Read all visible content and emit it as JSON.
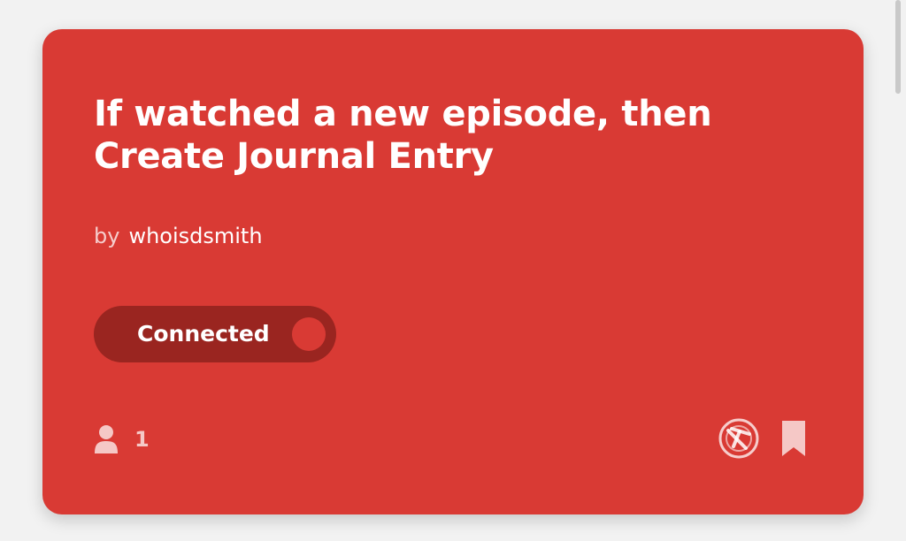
{
  "applet": {
    "title": "If watched a new episode, then Create Journal Entry",
    "by_label": "by",
    "author": "whoisdsmith",
    "toggle_label": "Connected",
    "users_count": "1"
  },
  "colors": {
    "card": "#d93a34",
    "toggle": "#9a2520",
    "text": "#ffffff"
  },
  "icons": {
    "users": "person-icon",
    "service": "trakt-logo-icon",
    "bookmark": "bookmark-icon"
  }
}
